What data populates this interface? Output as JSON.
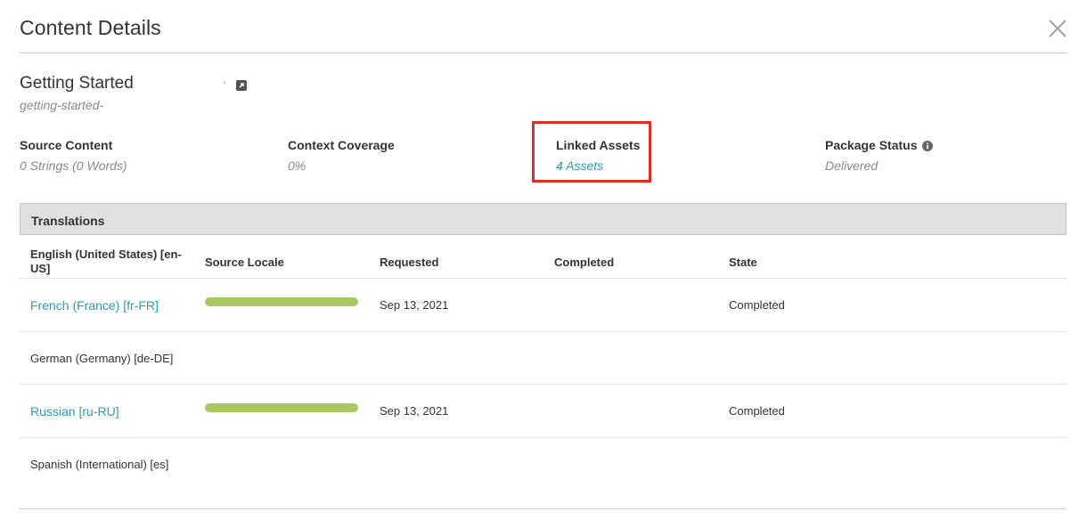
{
  "header": {
    "title": "Content Details"
  },
  "content": {
    "name": "Getting Started",
    "slug": "getting-started-"
  },
  "stats": {
    "source_content": {
      "label": "Source Content",
      "value": "0 Strings (0 Words)"
    },
    "context_coverage": {
      "label": "Context Coverage",
      "value": "0%"
    },
    "linked_assets": {
      "label": "Linked Assets",
      "value": "4 Assets"
    },
    "package_status": {
      "label": "Package Status",
      "value": "Delivered"
    }
  },
  "translations": {
    "title": "Translations",
    "columns": {
      "locale": "English (United States) [en-US]",
      "source_locale": "Source Locale",
      "requested": "Requested",
      "completed": "Completed",
      "state": "State"
    },
    "rows": [
      {
        "locale": "French (France) [fr-FR]",
        "progress": 1.0,
        "requested": "Sep 13, 2021",
        "completed": "",
        "state": "Completed"
      },
      {
        "locale": "German (Germany) [de-DE]",
        "progress": null,
        "requested": "",
        "completed": "",
        "state": ""
      },
      {
        "locale": "Russian [ru-RU]",
        "progress": 1.0,
        "requested": "Sep 13, 2021",
        "completed": "",
        "state": "Completed"
      },
      {
        "locale": "Spanish (International) [es]",
        "progress": null,
        "requested": "",
        "completed": "",
        "state": ""
      }
    ]
  },
  "colors": {
    "link": "#2a9db2",
    "progress": "#a9c861",
    "highlight": "#e32c23"
  }
}
